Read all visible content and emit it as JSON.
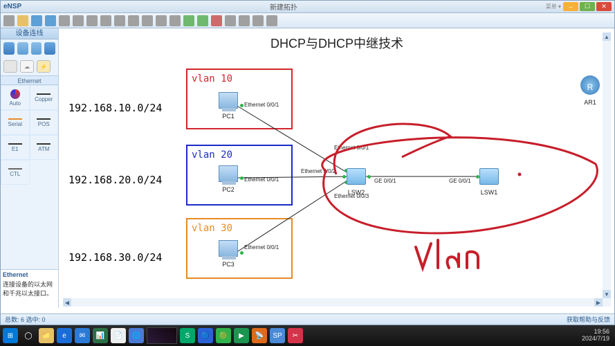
{
  "title_bar": {
    "app": "eNSP",
    "tab": "新建拓扑",
    "user_menu": "菜单 ▾"
  },
  "win_controls": {
    "min": "–",
    "max": "☐",
    "close": "✕"
  },
  "toolbar_icons": [
    "cursor",
    "folder",
    "save",
    "save",
    "undo",
    "redo",
    "sync",
    "start",
    "find",
    "zoom-in",
    "zoom-out",
    "fit",
    "green",
    "green",
    "green",
    "red",
    "gray",
    "gray",
    "gray",
    "gray",
    "gray",
    "gray"
  ],
  "sidebar": {
    "header": "设备连线",
    "section_device": "",
    "section_cable": "Ethernet",
    "cables": [
      {
        "label": "Auto",
        "cls": "auto"
      },
      {
        "label": "Copper",
        "cls": ""
      },
      {
        "label": "Serial",
        "cls": "serial"
      },
      {
        "label": "POS",
        "cls": ""
      },
      {
        "label": "E1",
        "cls": "e1"
      },
      {
        "label": "ATM",
        "cls": ""
      },
      {
        "label": "CTL",
        "cls": "ctl"
      },
      {
        "label": "",
        "cls": ""
      }
    ],
    "info": {
      "hdr": "Ethernet",
      "desc": "连接设备的以太网和千兆以太接口。"
    }
  },
  "canvas": {
    "title": "DHCP与DHCP中继技术",
    "subnets": [
      "192.168.10.0/24",
      "192.168.20.0/24",
      "192.168.30.0/24"
    ],
    "vlans": [
      {
        "name": "vlan 10",
        "cls": "vlan10"
      },
      {
        "name": "vlan 20",
        "cls": "vlan20"
      },
      {
        "name": "vlan 30",
        "cls": "vlan30"
      }
    ],
    "nodes": {
      "pc1": "PC1",
      "pc2": "PC2",
      "pc3": "PC3",
      "lsw2": "LSW2",
      "lsw1": "LSW1",
      "ar1": "AR1",
      "r": "R"
    },
    "ports": {
      "pc_eth": "Ethernet 0/0/1",
      "lsw2_e1": "Ethernet 0/0/1",
      "lsw2_e2": "Ethernet 0/0/2",
      "lsw2_e3": "Ethernet 0/0/3",
      "lsw2_ge": "GE 0/0/1",
      "lsw1_ge": "GE 0/0/1"
    },
    "annotation": "vlan"
  },
  "status": {
    "left": "总数: 6 选中: 0",
    "right": "获取帮助与反馈"
  },
  "taskbar": {
    "items": [
      "⊞",
      "◯",
      "📁",
      "e",
      "✉",
      "📊",
      "📄",
      "🌐",
      "S",
      "🔵",
      "🟢",
      "▶",
      "📡",
      "SP",
      "✂"
    ],
    "clock_time": "19:56",
    "clock_date": "2024/7/19"
  }
}
